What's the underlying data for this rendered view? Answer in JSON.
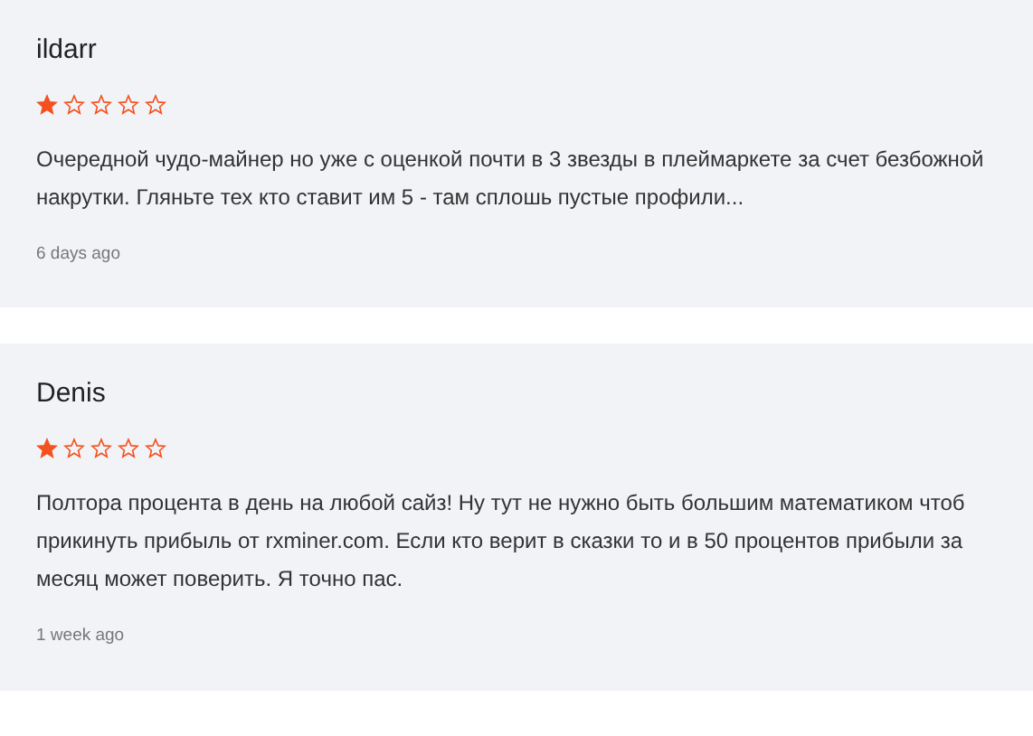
{
  "reviews": [
    {
      "author": "ildarr",
      "stars": 1,
      "text": "Очередной чудо-майнер но уже с оценкой почти в 3 звезды в плеймаркете за счет безбожной накрутки. Гляньте тех кто ставит им 5 - там сплошь пустые профили...",
      "time": "6 days ago"
    },
    {
      "author": "Denis",
      "stars": 1,
      "text": "Полтора процента в день на любой сайз! Ну тут не нужно быть большим математиком чтоб прикинуть прибыль от rxminer.com. Если кто верит в сказки то и в 50 процентов прибыли за месяц может поверить. Я точно пас.",
      "time": "1 week ago"
    }
  ]
}
